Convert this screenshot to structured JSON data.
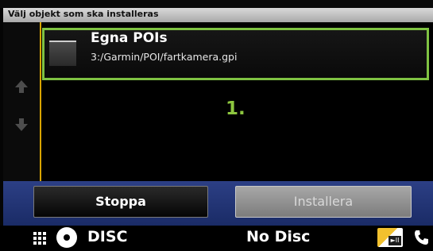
{
  "dialog": {
    "title": "Välj objekt som ska installeras"
  },
  "list": {
    "items": [
      {
        "title": "Egna POIs",
        "path": "3:/Garmin/POI/fartkamera.gpi",
        "checked": false
      }
    ],
    "scroll_up_icon": "arrow-up-icon",
    "scroll_down_icon": "arrow-down-icon"
  },
  "annotation": {
    "step": "1."
  },
  "buttons": {
    "stop_label": "Stoppa",
    "install_label": "Installera",
    "install_enabled": false
  },
  "status_bar": {
    "menu_icon": "grid-menu-icon",
    "source_icon": "disc-icon",
    "source_label": "DISC",
    "disc_status": "No Disc",
    "player_icon": "media-player-icon",
    "phone_icon": "phone-icon"
  },
  "colors": {
    "highlight": "#7fc242",
    "annotation": "#8dc63f",
    "accent_line": "#d9a400",
    "button_bar": "#213475"
  }
}
